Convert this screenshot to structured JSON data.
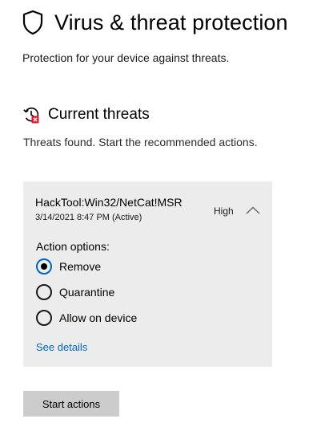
{
  "header": {
    "title": "Virus & threat protection",
    "subtitle": "Protection for your device against threats.",
    "icon": "shield-icon"
  },
  "current_threats": {
    "title": "Current threats",
    "description": "Threats found. Start the recommended actions.",
    "icon": "threat-history-icon",
    "threat": {
      "name": "HackTool:Win32/NetCat!MSR",
      "date": "3/14/2021 8:47 PM (Active)",
      "severity": "High",
      "expanded": true,
      "action_label": "Action options:",
      "options": [
        {
          "label": "Remove",
          "selected": true
        },
        {
          "label": "Quarantine",
          "selected": false
        },
        {
          "label": "Allow on device",
          "selected": false
        }
      ],
      "details_link": "See details"
    },
    "start_button": "Start actions"
  },
  "colors": {
    "accent": "#0067c0",
    "card_background": "#ececec",
    "button_background": "#cccccc",
    "alert_red": "#e81123"
  }
}
